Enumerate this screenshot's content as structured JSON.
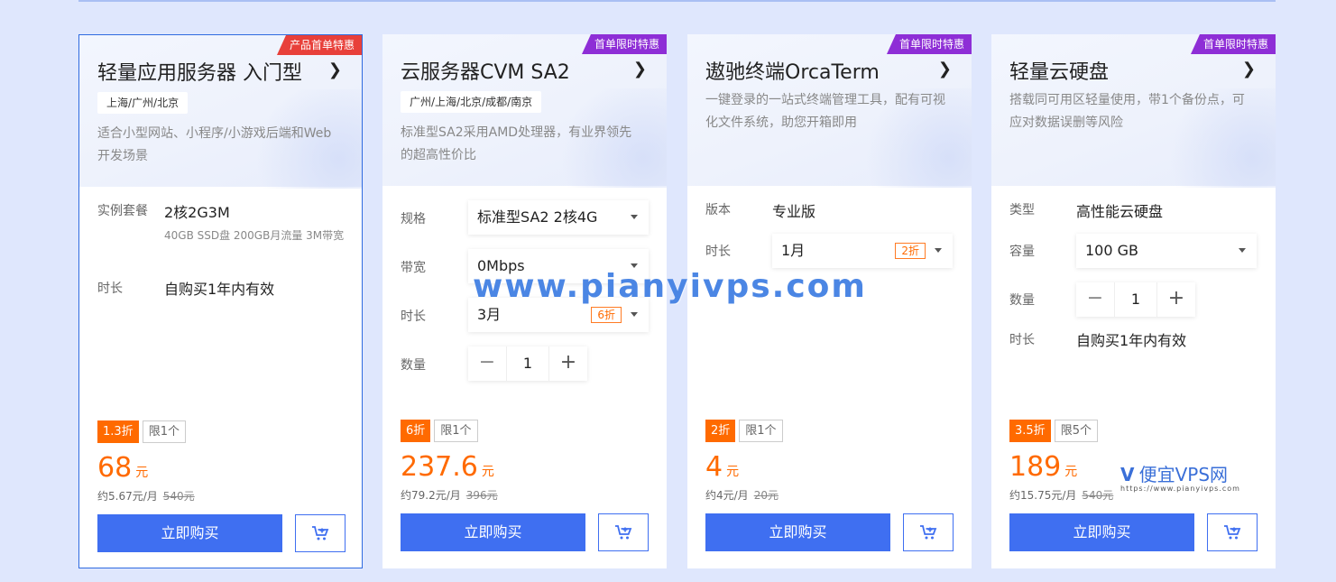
{
  "watermark": "www.pianyivps.com",
  "logo": {
    "letter": "V",
    "text": "便宜VPS网",
    "url": "https://www.pianyivps.com"
  },
  "cards": [
    {
      "badge": "产品首单特惠",
      "title": "轻量应用服务器 入门型",
      "region": "上海/广州/北京",
      "desc": "适合小型网站、小程序/小游戏后端和Web开发场景",
      "rows": {
        "r1_label": "实例套餐",
        "r1_value": "2核2G3M",
        "r1_sub": "40GB SSD盘 200GB月流量 3M带宽",
        "r2_label": "时长",
        "r2_value": "自购买1年内有效"
      },
      "discount": "1.3折",
      "limit": "限1个",
      "price": "68",
      "unit": "元",
      "monthly": "约5.67元/月",
      "original": "540元",
      "buy": "立即购买"
    },
    {
      "badge": "首单限时特惠",
      "title": "云服务器CVM SA2",
      "region": "广州/上海/北京/成都/南京",
      "desc": "标准型SA2采用AMD处理器，有业界领先的超高性价比",
      "rows": {
        "r1_label": "规格",
        "r1_value": "标准型SA2 2核4G",
        "r2_label": "带宽",
        "r2_value": "0Mbps",
        "r3_label": "时长",
        "r3_value": "3月",
        "r3_tag": "6折",
        "r4_label": "数量",
        "r4_value": "1"
      },
      "discount": "6折",
      "limit": "限1个",
      "price": "237.6",
      "unit": "元",
      "monthly": "约79.2元/月",
      "original": "396元",
      "buy": "立即购买"
    },
    {
      "badge": "首单限时特惠",
      "title": "遨驰终端OrcaTerm",
      "desc": "一键登录的一站式终端管理工具，配有可视化文件系统，助您开箱即用",
      "rows": {
        "r1_label": "版本",
        "r1_value": "专业版",
        "r2_label": "时长",
        "r2_value": "1月",
        "r2_tag": "2折"
      },
      "discount": "2折",
      "limit": "限1个",
      "price": "4",
      "unit": "元",
      "monthly": "约4元/月",
      "original": "20元",
      "buy": "立即购买"
    },
    {
      "badge": "首单限时特惠",
      "title": "轻量云硬盘",
      "desc": "搭载同可用区轻量使用，带1个备份点，可应对数据误删等风险",
      "rows": {
        "r1_label": "类型",
        "r1_value": "高性能云硬盘",
        "r2_label": "容量",
        "r2_value": "100 GB",
        "r3_label": "数量",
        "r3_value": "1",
        "r4_label": "时长",
        "r4_value": "自购买1年内有效"
      },
      "discount": "3.5折",
      "limit": "限5个",
      "price": "189",
      "unit": "元",
      "monthly": "约15.75元/月",
      "original": "540元",
      "buy": "立即购买"
    }
  ]
}
